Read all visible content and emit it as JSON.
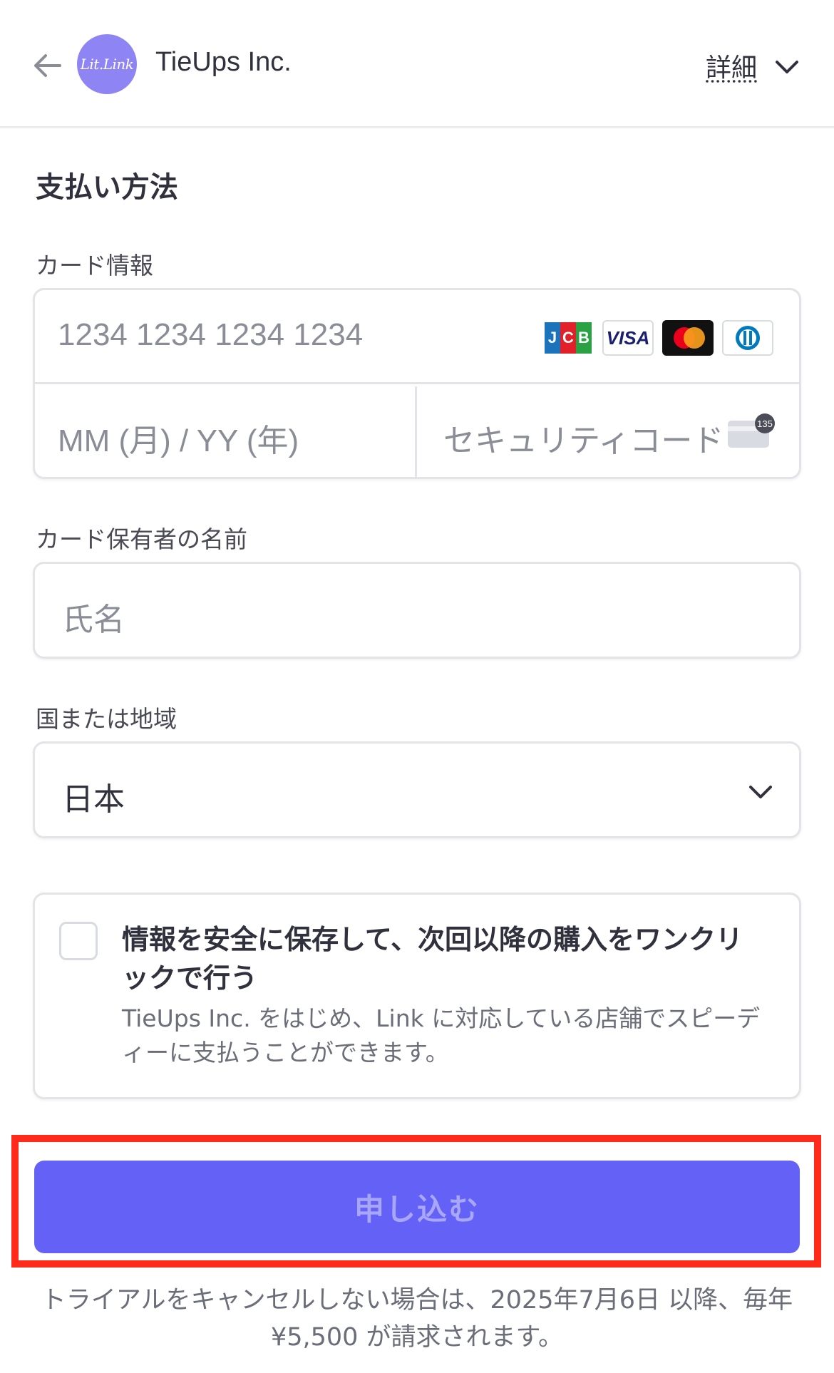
{
  "header": {
    "logo_text": "Lit.Link",
    "merchant_name": "TieUps Inc.",
    "details_label": "詳細"
  },
  "payment": {
    "section_title": "支払い方法",
    "card_info_label": "カード情報",
    "card_number_placeholder": "1234 1234 1234 1234",
    "expiry_placeholder": "MM (月) / YY (年)",
    "cvc_placeholder": "セキュリティコード",
    "cvc_icon_text": "135",
    "card_brands": [
      "JCB",
      "VISA",
      "Mastercard",
      "Diners Club"
    ],
    "cardholder_label": "カード保有者の名前",
    "cardholder_placeholder": "氏名",
    "country_label": "国または地域",
    "country_value": "日本"
  },
  "save": {
    "checked": false,
    "title": "情報を安全に保存して、次回以降の購入をワンクリックで行う",
    "description": "TieUps Inc. をはじめ、Link に対応している店舗でスピーディーに支払うことができます。"
  },
  "submit": {
    "label": "申し込む"
  },
  "notice": "トライアルをキャンセルしない場合は、2025年7月6日 以降、毎年 ¥5,500 が請求されます。",
  "colors": {
    "accent": "#6361f6",
    "logo_bg": "#8f84f4",
    "highlight": "#ff2a1a"
  }
}
